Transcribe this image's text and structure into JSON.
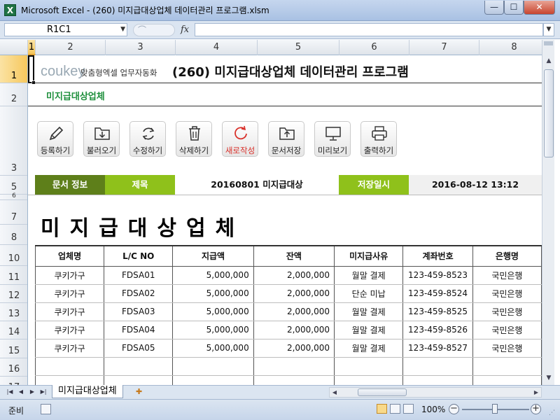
{
  "window": {
    "app_icon": "X",
    "title": "Microsoft Excel - (260) 미지급대상업체 데이터관리 프로그램.xlsm",
    "min_glyph": "—",
    "max_glyph": "☐",
    "close_glyph": "✕"
  },
  "formula_bar": {
    "name_box": "R1C1",
    "fx": "fx",
    "formula": ""
  },
  "columns": [
    "1",
    "2",
    "3",
    "4",
    "5",
    "6",
    "7",
    "8"
  ],
  "rows": [
    "1",
    "2",
    "3",
    "5",
    "6",
    "7",
    "8",
    "10",
    "11",
    "12",
    "13",
    "14",
    "15",
    "16",
    "17"
  ],
  "header": {
    "logo": "coukey",
    "logo_sub": "맞춤형엑셀 업무자동화",
    "title": "(260) 미지급대상업체 데이터관리 프로그램",
    "subtitle": "미지급대상업체"
  },
  "toolbar": {
    "buttons": [
      {
        "label": "등록하기",
        "icon": "pencil-icon"
      },
      {
        "label": "불러오기",
        "icon": "folder-download-icon"
      },
      {
        "label": "수정하기",
        "icon": "refresh-icon"
      },
      {
        "label": "삭제하기",
        "icon": "trash-icon"
      },
      {
        "label": "새로작성",
        "icon": "new-doc-icon"
      },
      {
        "label": "문서저장",
        "icon": "folder-upload-icon"
      },
      {
        "label": "미리보기",
        "icon": "monitor-icon"
      },
      {
        "label": "출력하기",
        "icon": "printer-icon"
      }
    ]
  },
  "doc_info": {
    "label": "문서 정보",
    "title_label": "제목",
    "title_value": "20160801 미지급대상",
    "saved_label": "저장일시",
    "saved_value": "2016-08-12 13:12"
  },
  "doc_heading": "미지급대상업체",
  "table": {
    "headers": [
      "업체명",
      "L/C NO",
      "지급액",
      "잔액",
      "미지급사유",
      "계좌번호",
      "은행명"
    ],
    "rows": [
      [
        "쿠키가구",
        "FDSA01",
        "5,000,000",
        "2,000,000",
        "월말 결제",
        "123-459-8523",
        "국민은행"
      ],
      [
        "쿠키가구",
        "FDSA02",
        "5,000,000",
        "2,000,000",
        "단순 미납",
        "123-459-8524",
        "국민은행"
      ],
      [
        "쿠키가구",
        "FDSA03",
        "5,000,000",
        "2,000,000",
        "월말 결제",
        "123-459-8525",
        "국민은행"
      ],
      [
        "쿠키가구",
        "FDSA04",
        "5,000,000",
        "2,000,000",
        "월말 결제",
        "123-459-8526",
        "국민은행"
      ],
      [
        "쿠키가구",
        "FDSA05",
        "5,000,000",
        "2,000,000",
        "월말 결제",
        "123-459-8527",
        "국민은행"
      ],
      [
        "",
        "",
        "",
        "",
        "",
        "",
        ""
      ],
      [
        "",
        "",
        "",
        "",
        "",
        "",
        ""
      ]
    ]
  },
  "sheet_tab": "미지급대상업체",
  "status": {
    "ready": "준비",
    "zoom": "100%",
    "zoom_minus": "−",
    "zoom_plus": "+"
  },
  "colors": {
    "info_dark": "#5e7f1a",
    "info_light": "#8fc11b",
    "subtitle_green": "#1e8f3c",
    "new_doc_red": "#d9302a"
  }
}
